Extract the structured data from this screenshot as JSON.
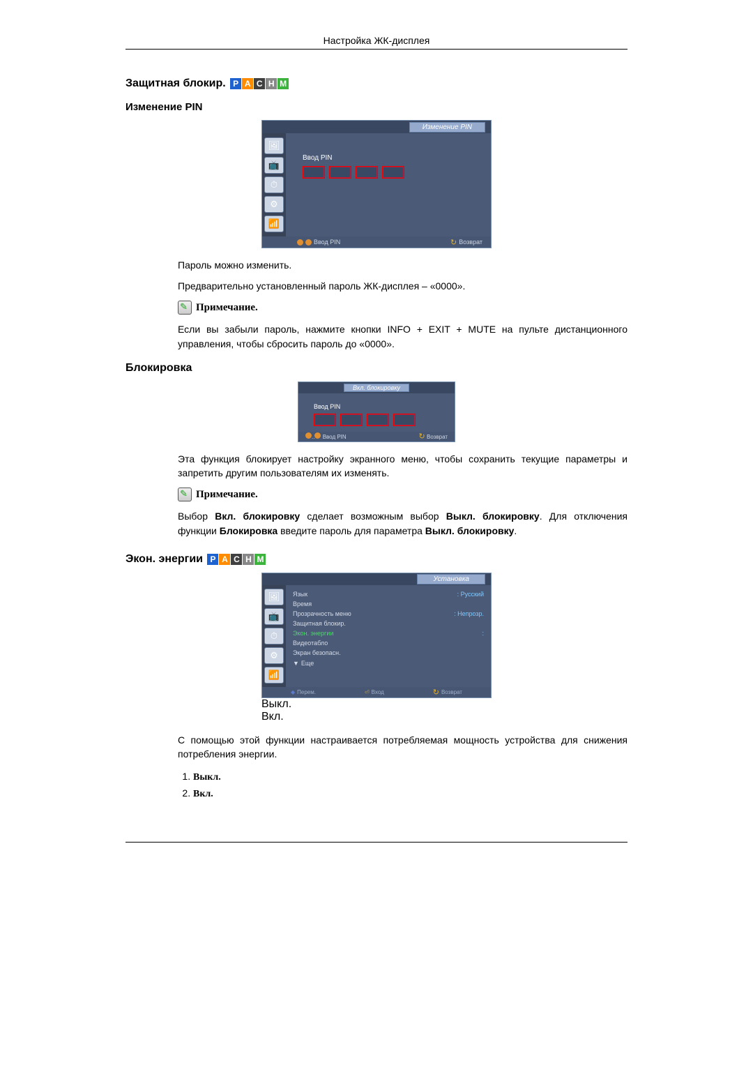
{
  "header": "Настройка ЖК-дисплея",
  "badges": [
    "P",
    "A",
    "C",
    "H",
    "M"
  ],
  "sec1": {
    "title": "Защитная блокир.",
    "sub": "Изменение PIN",
    "osd": {
      "title": "Изменение PIN",
      "label": "Ввод PIN",
      "footer_left": "Ввод PIN",
      "footer_right": "Возврат"
    },
    "p1": "Пароль можно изменить.",
    "p2": "Предварительно установленный пароль ЖК-дисплея – «0000».",
    "note": "Примечание.",
    "p3": "Если вы забыли пароль, нажмите кнопки INFO + EXIT + MUTE на пульте дистанционного управления, чтобы сбросить пароль до «0000»."
  },
  "sec2": {
    "title": "Блокировка",
    "osd": {
      "title": "Вкл. блокировку",
      "label": "Ввод PIN",
      "footer_left": "Ввод PIN",
      "footer_right": "Возврат"
    },
    "p1": "Эта функция блокирует настройку экранного меню, чтобы сохранить текущие параметры и запретить другим пользователям их изменять.",
    "note": "Примечание.",
    "p2_a": "Выбор ",
    "p2_b": "Вкл. блокировку",
    "p2_c": " сделает возможным выбор ",
    "p2_d": "Выкл. блокировку",
    "p2_e": ". Для отключения функции ",
    "p2_f": "Блокировка",
    "p2_g": " введите пароль для параметра ",
    "p2_h": "Выкл. блокировку",
    "p2_i": "."
  },
  "sec3": {
    "title": "Экон. энергии ",
    "osd": {
      "title": "Установка",
      "rows": {
        "lang_k": "Язык",
        "lang_v": ": Русский",
        "time_k": "Время",
        "trans_k": "Прозрачность меню",
        "trans_v": ": Непрозр.",
        "lock_k": "Защитная блокир.",
        "energy_k": "Экон. энергии",
        "energy_v": ":",
        "vid_k": "Видеотабло",
        "safe_k": "Экран безопасн."
      },
      "popup_off": "Выкл.",
      "popup_on": "Вкл.",
      "more": "Еще",
      "footer_move": "Перем.",
      "footer_enter": "Вход",
      "footer_return": "Возврат"
    },
    "p1": "С помощью этой функции настраивается потребляемая мощность устройства для снижения потребления энергии.",
    "li1": "Выкл.",
    "li2": "Вкл."
  }
}
